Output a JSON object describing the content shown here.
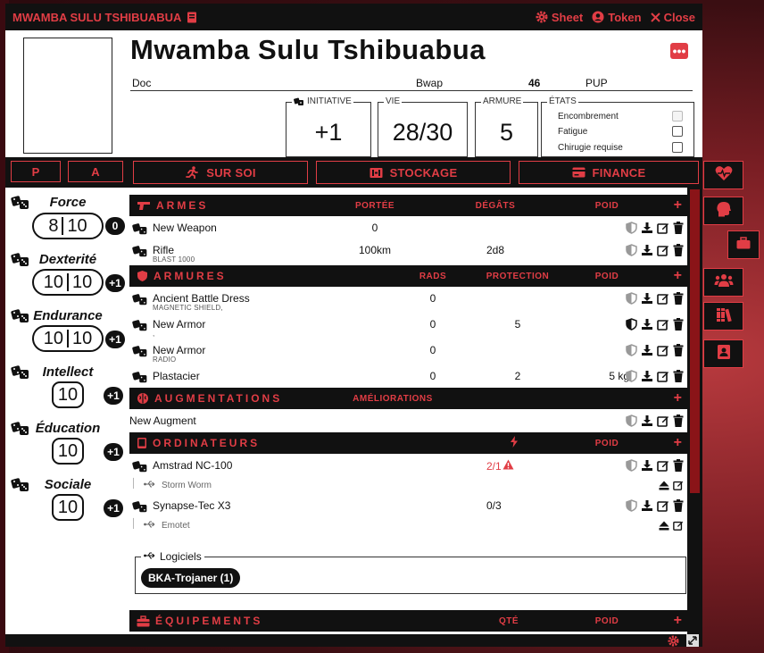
{
  "window": {
    "title": "MWAMBA SULU TSHIBUABUA",
    "sheet_label": "Sheet",
    "token_label": "Token",
    "close_label": "Close"
  },
  "character": {
    "name": "Mwamba Sulu Tshibuabua",
    "role": "Doc",
    "species": "Bwap",
    "age": "46",
    "origin": "PUP"
  },
  "stats": {
    "initiative_label": "INITIATIVE",
    "initiative": "+1",
    "vie_label": "VIE",
    "vie": "28/30",
    "armure_label": "ARMURE",
    "armure": "5"
  },
  "etats": {
    "label": "ÉTATS",
    "items": [
      {
        "label": "Encombrement",
        "checked": false,
        "disabled": true
      },
      {
        "label": "Fatigue",
        "checked": false,
        "disabled": false
      },
      {
        "label": "Chirugie requise",
        "checked": false,
        "disabled": false
      }
    ]
  },
  "side_tabs": {
    "p": "P",
    "a": "A"
  },
  "tabs": [
    {
      "label": "SUR SOI",
      "icon": "running-person-icon",
      "active": true
    },
    {
      "label": "STOCKAGE",
      "icon": "storage-icon",
      "active": false
    },
    {
      "label": "FINANCE",
      "icon": "credit-card-icon",
      "active": false
    }
  ],
  "attributes": [
    {
      "name": "Force",
      "value": "8",
      "max": "10",
      "bonus": "0"
    },
    {
      "name": "Dexterité",
      "value": "10",
      "max": "10",
      "bonus": "+1"
    },
    {
      "name": "Endurance",
      "value": "10",
      "max": "10",
      "bonus": "+1"
    },
    {
      "name": "Intellect",
      "value": "10",
      "bonus": "+1"
    },
    {
      "name": "Éducation",
      "value": "10",
      "bonus": "+1"
    },
    {
      "name": "Sociale",
      "value": "10",
      "bonus": "+1"
    }
  ],
  "armes": {
    "title": "ARMES",
    "cols": {
      "portee": "PORTÉE",
      "degats": "DÉGÂTS",
      "poid": "POID"
    },
    "items": [
      {
        "name": "New Weapon",
        "sub": "",
        "portee": "0",
        "degats": "",
        "poid": ""
      },
      {
        "name": "Rifle",
        "sub": "BLAST 1000",
        "portee": "100km",
        "degats": "2d8",
        "poid": ""
      }
    ]
  },
  "armures": {
    "title": "ARMURES",
    "cols": {
      "rads": "RADS",
      "protection": "PROTECTION",
      "poid": "POID"
    },
    "items": [
      {
        "name": "Ancient Battle Dress",
        "sub": "MAGNETIC SHIELD,",
        "rads": "0",
        "protection": "",
        "poid": "",
        "equipped": false
      },
      {
        "name": "New Armor",
        "sub": ",",
        "rads": "0",
        "protection": "5",
        "poid": "",
        "equipped": true
      },
      {
        "name": "New Armor",
        "sub": "RADIO",
        "rads": "0",
        "protection": "",
        "poid": "",
        "equipped": false
      },
      {
        "name": "Plastacier",
        "sub": "",
        "rads": "0",
        "protection": "2",
        "poid": "5 kg",
        "equipped": false
      }
    ]
  },
  "augmentations": {
    "title": "AUGMENTATIONS",
    "cols": {
      "ameliorations": "AMÉLIORATIONS"
    },
    "items": [
      {
        "name": "New Augment"
      }
    ]
  },
  "ordinateurs": {
    "title": "ORDINATEURS",
    "cols": {
      "poid": "POID"
    },
    "items": [
      {
        "name": "Amstrad NC-100",
        "bandwidth": "2/1",
        "warning": true,
        "software": "Storm Worm"
      },
      {
        "name": "Synapse-Tec X3",
        "bandwidth": "0/3",
        "warning": false,
        "software": "Emotet"
      }
    ]
  },
  "logiciels": {
    "label": "Logiciels",
    "chips": [
      "BKA-Trojaner (1)"
    ]
  },
  "equipements": {
    "title": "ÉQUIPEMENTS",
    "cols": {
      "qte": "QTÉ",
      "poid": "POID"
    }
  },
  "colors": {
    "accent": "#e13d45",
    "dark": "#111111",
    "scroll_thumb": "#8a1418"
  }
}
